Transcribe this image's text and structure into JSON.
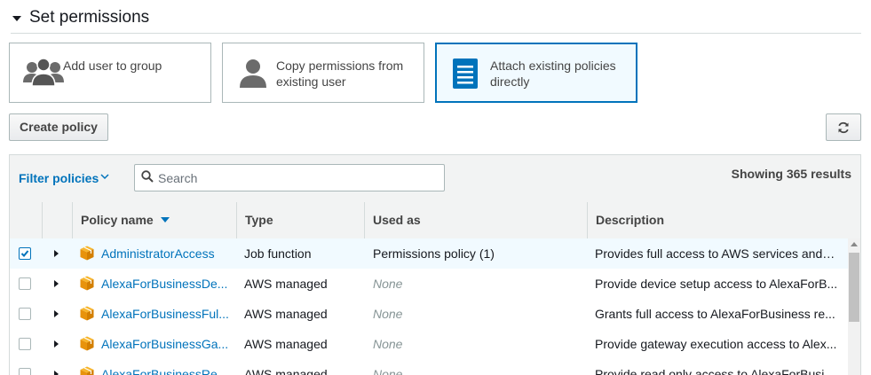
{
  "section": {
    "title": "Set permissions"
  },
  "options": [
    {
      "label": "Add user to group",
      "icon": "users-group-icon",
      "selected": false
    },
    {
      "label": "Copy permissions from existing user",
      "icon": "user-icon",
      "selected": false
    },
    {
      "label": "Attach existing policies directly",
      "icon": "document-icon",
      "selected": true
    }
  ],
  "toolbar": {
    "create_policy_label": "Create policy",
    "refresh_icon": "refresh-icon"
  },
  "filter": {
    "label": "Filter policies",
    "search_placeholder": "Search",
    "search_value": "",
    "results_text": "Showing 365 results"
  },
  "table": {
    "columns": [
      "Policy name",
      "Type",
      "Used as",
      "Description"
    ],
    "sort_column": "Policy name",
    "rows": [
      {
        "checked": true,
        "name": "AdministratorAccess",
        "type": "Job function",
        "used_as": "Permissions policy (1)",
        "description": "Provides full access to AWS services and r..."
      },
      {
        "checked": false,
        "name": "AlexaForBusinessDe...",
        "type": "AWS managed",
        "used_as": "None",
        "description": "Provide device setup access to AlexaForB..."
      },
      {
        "checked": false,
        "name": "AlexaForBusinessFul...",
        "type": "AWS managed",
        "used_as": "None",
        "description": "Grants full access to AlexaForBusiness re..."
      },
      {
        "checked": false,
        "name": "AlexaForBusinessGa...",
        "type": "AWS managed",
        "used_as": "None",
        "description": "Provide gateway execution access to Alex..."
      },
      {
        "checked": false,
        "name": "AlexaForBusinessRe...",
        "type": "AWS managed",
        "used_as": "None",
        "description": "Provide read only access to AlexaForBusin..."
      }
    ]
  },
  "colors": {
    "accent": "#0073bb",
    "selected_bg": "#f1faff",
    "policy_icon": "#f0a30a"
  }
}
